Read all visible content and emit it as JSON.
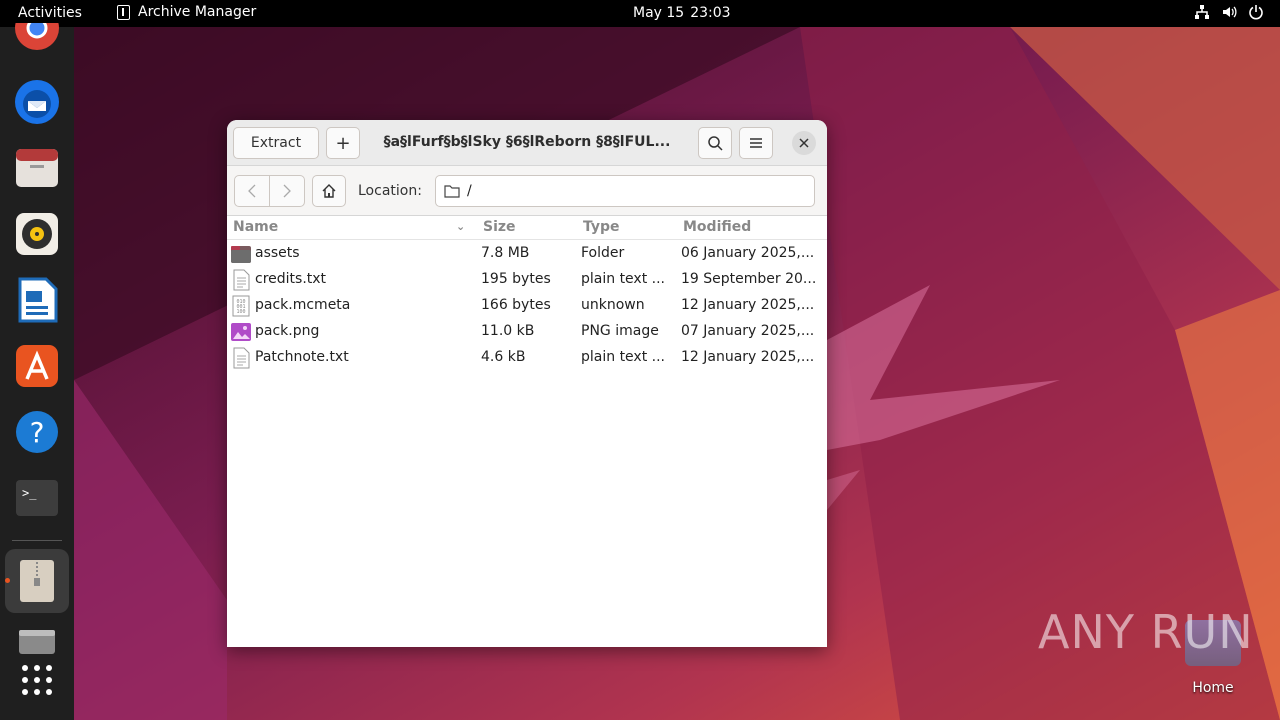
{
  "topbar": {
    "activities": "Activities",
    "app_name": "Archive Manager",
    "date": "May 15",
    "time": "23:03"
  },
  "dock": {
    "items": [
      "chrome-icon",
      "thunderbird-icon",
      "files-icon",
      "rhythmbox-icon",
      "libreoffice-writer-icon",
      "app-center-icon",
      "help-icon",
      "terminal-icon",
      "archive-manager-icon",
      "disk-icon",
      "show-apps-icon"
    ]
  },
  "window": {
    "extract_label": "Extract",
    "add_label": "+",
    "title": "§a§lFurf§b§lSky §6§lReborn §8§lFUL...",
    "location_label": "Location:",
    "location_value": "/"
  },
  "list": {
    "columns": [
      "Name",
      "Size",
      "Type",
      "Modified"
    ],
    "rows": [
      {
        "name": "assets",
        "size": "7.8 MB",
        "type": "Folder",
        "modified": "06 January 2025,...",
        "icon": "folder-icon"
      },
      {
        "name": "credits.txt",
        "size": "195 bytes",
        "type": "plain text ...",
        "modified": "19 September 20...",
        "icon": "text-file-icon"
      },
      {
        "name": "pack.mcmeta",
        "size": "166 bytes",
        "type": "unknown",
        "modified": "12 January 2025,...",
        "icon": "binary-file-icon"
      },
      {
        "name": "pack.png",
        "size": "11.0 kB",
        "type": "PNG image",
        "modified": "07 January 2025,...",
        "icon": "image-file-icon"
      },
      {
        "name": "Patchnote.txt",
        "size": "4.6 kB",
        "type": "plain text ...",
        "modified": "12 January 2025,...",
        "icon": "text-file-icon"
      }
    ]
  },
  "desktop": {
    "home_label": "Home",
    "watermark": "ANY RUN"
  },
  "colors": {
    "accent": "#e95420",
    "topbar": "#000000",
    "dock": "#1f1f1f"
  }
}
